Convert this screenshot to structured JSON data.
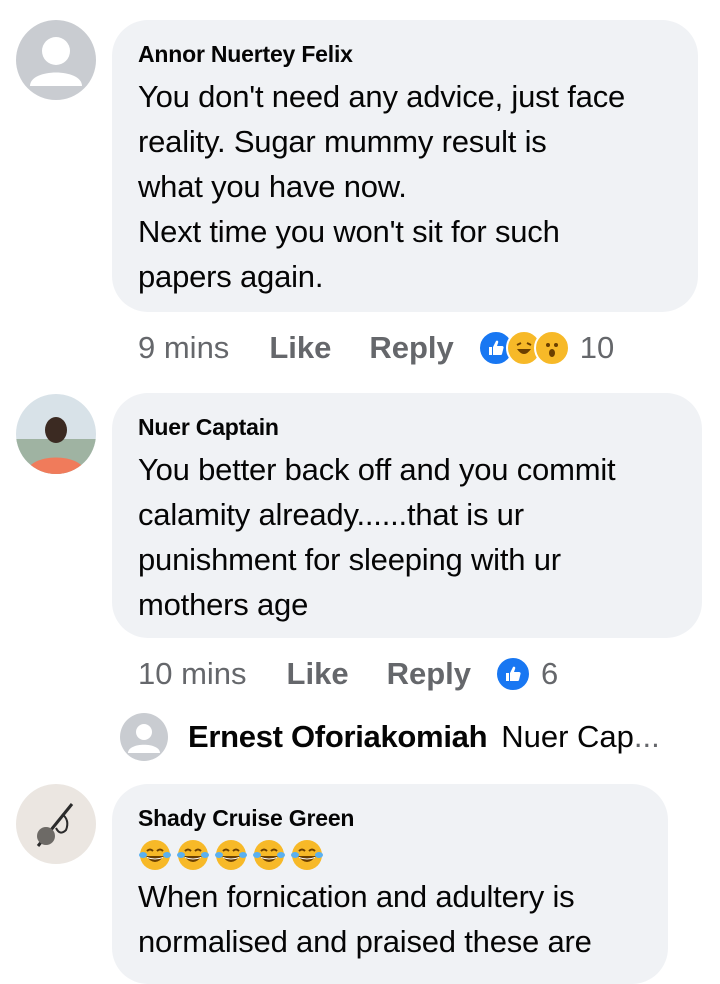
{
  "comments": [
    {
      "author": "Annor Nuertey Felix",
      "lines": [
        "You don't need any advice, just face",
        "reality. Sugar mummy result is",
        "what you have now.",
        "Next time you won't sit for such",
        "papers again."
      ],
      "time": "9 mins",
      "like_label": "Like",
      "reply_label": "Reply",
      "reactions": [
        "like-icon",
        "haha-icon",
        "wow-icon"
      ],
      "reaction_count": "10"
    },
    {
      "author": "Nuer Captain",
      "lines": [
        "You better back off and you commit",
        "calamity already......that is ur",
        "punishment for sleeping with ur",
        "mothers age"
      ],
      "time": "10 mins",
      "like_label": "Like",
      "reply_label": "Reply",
      "reactions": [
        "like-icon"
      ],
      "reaction_count": "6"
    },
    {
      "author": "Shady Cruise Green",
      "emoji": [
        "😂",
        "😂",
        "😂",
        "😂",
        "😂"
      ],
      "lines": [
        "When fornication and adultery is",
        "normalised and praised these are"
      ]
    }
  ],
  "reply_preview": {
    "name": "Ernest Oforiakomiah",
    "text": "Nuer Cap",
    "ellipsis": "..."
  },
  "colors": {
    "bubble": "#f0f2f5",
    "meta_text": "#65676b",
    "like_blue": "#1877f2",
    "haha_yellow": "#f7b928"
  }
}
